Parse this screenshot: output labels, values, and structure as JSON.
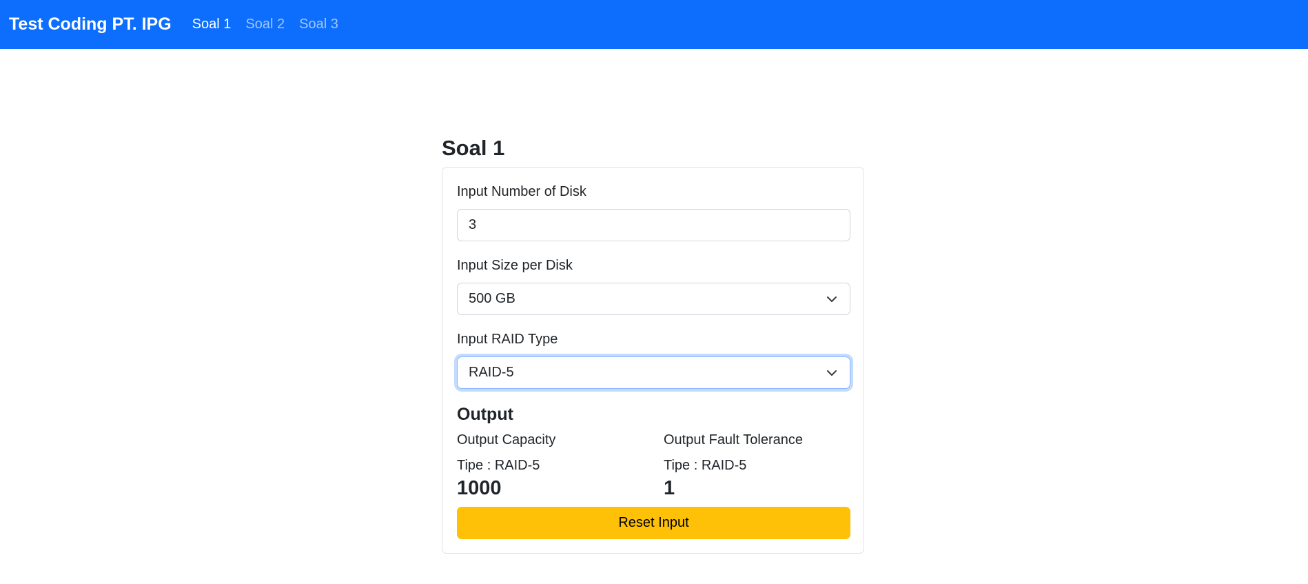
{
  "navbar": {
    "brand": "Test Coding PT. IPG",
    "links": [
      {
        "label": "Soal 1",
        "active": true
      },
      {
        "label": "Soal 2",
        "active": false
      },
      {
        "label": "Soal 3",
        "active": false
      }
    ],
    "color": "#0d6efd"
  },
  "main": {
    "title": "Soal 1",
    "form": {
      "disk_count": {
        "label": "Input Number of Disk",
        "value": "3"
      },
      "disk_size": {
        "label": "Input Size per Disk",
        "value": "500 GB"
      },
      "raid_type": {
        "label": "Input RAID Type",
        "value": "RAID-5",
        "focused": true
      }
    },
    "output": {
      "heading": "Output",
      "capacity": {
        "label": "Output Capacity",
        "type": "Tipe : RAID-5",
        "value": "1000"
      },
      "fault_tolerance": {
        "label": "Output Fault Tolerance",
        "type": "Tipe : RAID-5",
        "value": "1"
      }
    },
    "reset_button": {
      "label": "Reset Input",
      "color": "#ffc107"
    }
  }
}
